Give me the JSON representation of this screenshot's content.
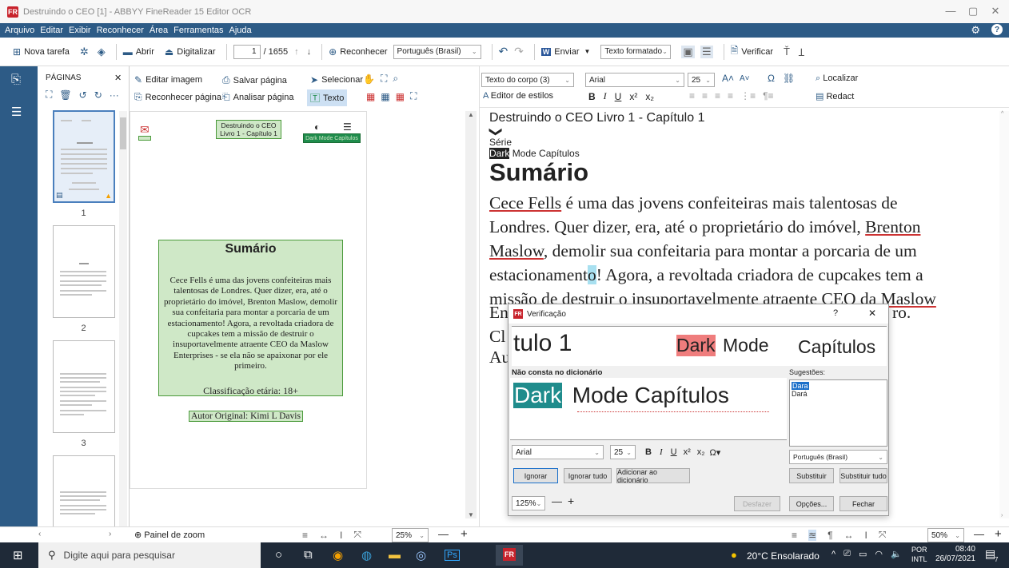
{
  "window": {
    "title": "Destruindo o CEO [1] - ABBYY FineReader 15 Editor OCR",
    "app_icon_label": "FR",
    "controls": [
      "—",
      "▢",
      "✕"
    ]
  },
  "menu": {
    "items": [
      "Arquivo",
      "Editar",
      "Exibir",
      "Reconhecer",
      "Área",
      "Ferramentas",
      "Ajuda"
    ]
  },
  "toolbar": {
    "new_task": "Nova tarefa",
    "open": "Abrir",
    "scan": "Digitalizar",
    "page_current": "1",
    "page_total": "/ 1655",
    "recognize": "Reconhecer",
    "language": "Português (Brasil)",
    "send": "Enviar",
    "text_mode": "Texto formatado",
    "verify": "Verificar"
  },
  "pages_panel": {
    "title": "PÁGINAS",
    "close": "✕",
    "more": "···",
    "page_numbers": [
      "1",
      "2",
      "3"
    ]
  },
  "image_toolbar": {
    "edit_image": "Editar imagem",
    "save_page": "Salvar página",
    "select": "Selecionar",
    "recognize_page": "Reconhecer página",
    "analyze_page": "Analisar página",
    "text": "Texto"
  },
  "image_doc": {
    "header_box": "Destruindo o CEO\nLivro 1 - Capítulo 1",
    "dark_mode_box": "Dark Mode  Capítulos",
    "summary_title": "Sumário",
    "summary_body": "Cece Fells é uma das jovens confeiteiras mais talentosas de Londres. Quer dizer, era, até o proprietário do imóvel, Brenton Maslow, demolir sua confeitaria para montar a porcaria de um estacionamento! Agora, a revoltada criadora de cupcakes tem a missão de destruir o insuportavelmente atraente CEO da Maslow Enterprises - se ela não se apaixonar por ele primeiro.",
    "rating": "Classificação etária: 18+",
    "author": "Autor Original: Kimi L Davis"
  },
  "text_toolbar": {
    "style": "Texto do corpo (3)",
    "font": "Arial",
    "size": "25",
    "find": "Localizar",
    "style_editor": "Editor de estilos",
    "redact": "Redact"
  },
  "text_doc": {
    "heading": "Destruindo o CEO Livro 1 - Capítulo 1",
    "chevron": "❯",
    "serie": "Série",
    "dark": "Dark",
    "mode_caps": "Mode Capítulos",
    "summary": "Sumário",
    "para_1_a": "Cece Fells",
    "para_1_b": " é uma das jovens confeiteiras mais talentosas de",
    "para_2_a": "Londres. Quer dizer, era, até o proprietário do imóvel, ",
    "para_2_b": "Brenton",
    "para_3_a": "Maslow",
    "para_3_b": ", demolir sua confeitaria para montar a porcaria de um",
    "para_4_a": "estacionament",
    "para_4_b": "o",
    "para_4_c": "! Agora, a revoltada criadora de cupcakes tem a",
    "para_5_a": "missão de destruir o insuportavelmente atraente CEO da ",
    "para_5_b": "Maslow",
    "para_6_a": "En",
    "para_6_b": "ro.",
    "para_7": "Cl",
    "para_8": "Au"
  },
  "dialog": {
    "title": "Verificação",
    "help": "?",
    "close": "✕",
    "preview_left": "tulo 1",
    "preview_dark": "Dark",
    "preview_mode": "Mode",
    "preview_caps": "Capítulos",
    "not_in_dict": "Não consta no dicionário",
    "suggestions_label": "Sugestões:",
    "word_dark": "Dark",
    "word_rest": " Mode Capítulos",
    "suggestions": [
      "Dara",
      "Dará"
    ],
    "font": "Arial",
    "size": "25",
    "language": "Português (Brasil)",
    "ignore": "Ignorar",
    "ignore_all": "Ignorar tudo",
    "add_dict": "Adicionar ao dicionário",
    "replace": "Substituir",
    "replace_all": "Substituir tudo",
    "zoom": "125%",
    "undo": "Desfazer",
    "options": "Opções...",
    "close_btn": "Fechar"
  },
  "bottom": {
    "zoom_panel": "Painel de zoom",
    "zoom_left": "25%",
    "zoom_right": "50%"
  },
  "taskbar": {
    "search_placeholder": "Digite aqui para pesquisar",
    "weather": "20°C Ensolarado",
    "lang_1": "POR",
    "lang_2": "INTL",
    "time": "08:40",
    "date": "26/07/2021",
    "notif_count": "7"
  },
  "colors": {
    "blue_bar": "#2d5b86",
    "highlight_green": "#cfe8c7",
    "selection_teal": "#1f8c8c",
    "dark_highlight": "#ef7d7d"
  }
}
